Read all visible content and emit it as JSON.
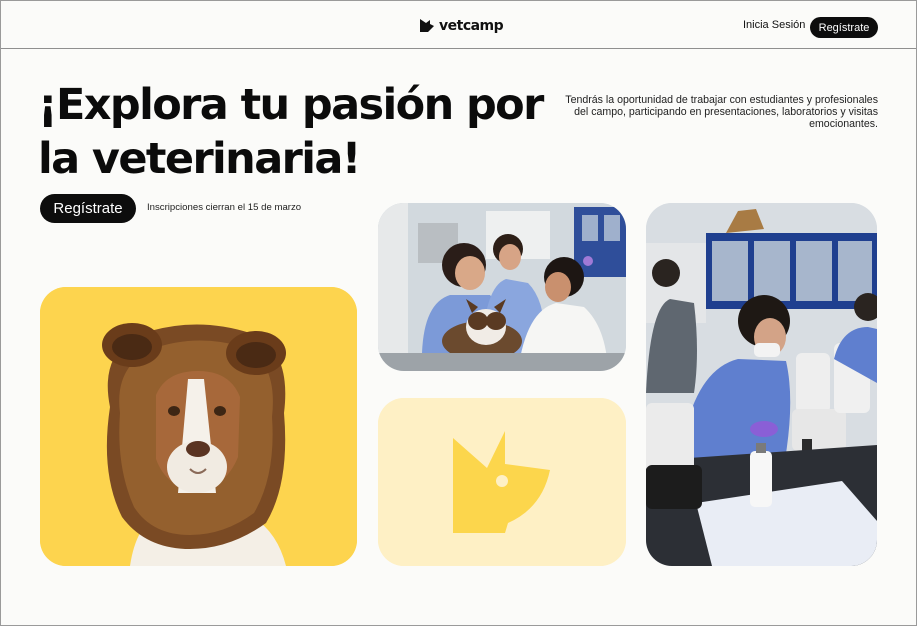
{
  "header": {
    "brand_name": "vetcamp",
    "login_label": "Inicia Sesión",
    "register_label": "Regístrate"
  },
  "hero": {
    "title": "¡Explora tu pasión por la veterinaria!",
    "description": "Tendrás la oportunidad de trabajar con estudiantes y profesionales del campo, participando en presentaciones, laboratorios y visitas emocionantes.",
    "register_label": "Regístrate",
    "deadline_text": "Inscripciones cierran el 15 de marzo"
  },
  "colors": {
    "page_background": "#fbfbf9",
    "button_background": "#0d0d0d",
    "dog_card_yellow": "#fdd44e",
    "brand_card_cream": "#fef0c5",
    "brand_mark_yellow": "#fcd64c"
  },
  "images": {
    "dog_photo": "dog-in-bear-hat-photo",
    "students_photo": "students-examining-dog-photo",
    "lab_photo": "students-with-microscopes-photo",
    "brand_mark": "vetcamp-dog-head-logo"
  }
}
